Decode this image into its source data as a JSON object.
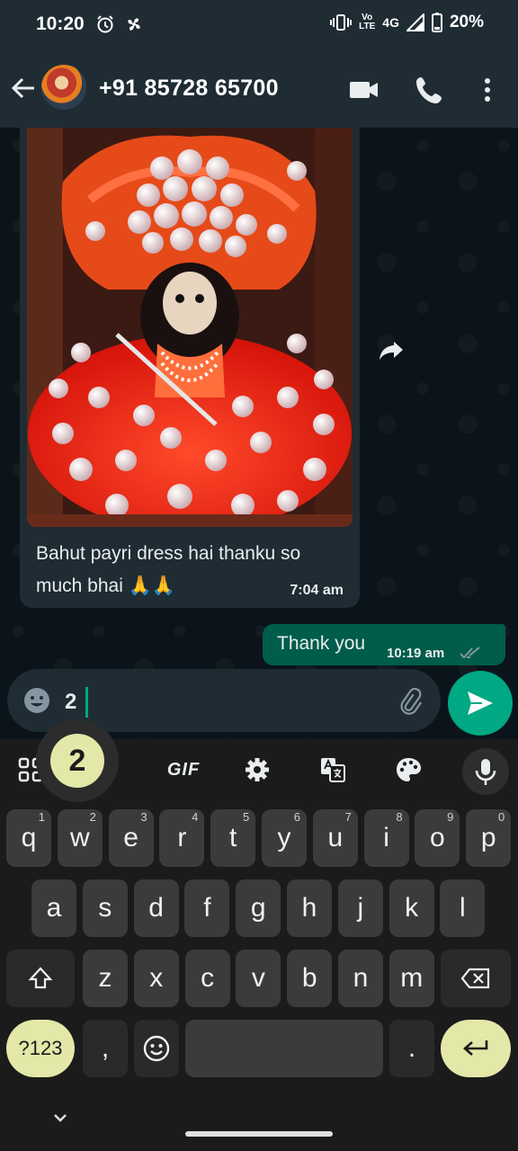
{
  "status_bar": {
    "time": "10:20",
    "network": "4G",
    "volte_line1": "Vo",
    "volte_line2": "LTE",
    "battery": "20%"
  },
  "header": {
    "contact": "+91 85728 65700"
  },
  "messages": {
    "incoming": {
      "text": "Bahut payri dress hai thanku so much bhai 🙏🙏",
      "time": "7:04 am"
    },
    "outgoing": {
      "text": "Thank you",
      "time": "10:19 am"
    }
  },
  "compose": {
    "value": "2"
  },
  "keyboard": {
    "popup": "2",
    "gif": "GIF",
    "row1": [
      {
        "key": "q",
        "hint": "1"
      },
      {
        "key": "w",
        "hint": "2"
      },
      {
        "key": "e",
        "hint": "3"
      },
      {
        "key": "r",
        "hint": "4"
      },
      {
        "key": "t",
        "hint": "5"
      },
      {
        "key": "y",
        "hint": "6"
      },
      {
        "key": "u",
        "hint": "7"
      },
      {
        "key": "i",
        "hint": "8"
      },
      {
        "key": "o",
        "hint": "9"
      },
      {
        "key": "p",
        "hint": "0"
      }
    ],
    "row2": [
      "a",
      "s",
      "d",
      "f",
      "g",
      "h",
      "j",
      "k",
      "l"
    ],
    "row3": [
      "z",
      "x",
      "c",
      "v",
      "b",
      "n",
      "m"
    ],
    "symbols": "?123",
    "comma": ",",
    "period": "."
  },
  "colors": {
    "accent": "#00a884",
    "outgoing_bubble": "#005c4b",
    "incoming_bubble": "#1f2c34",
    "keyboard_accent": "#e3e7a8"
  }
}
